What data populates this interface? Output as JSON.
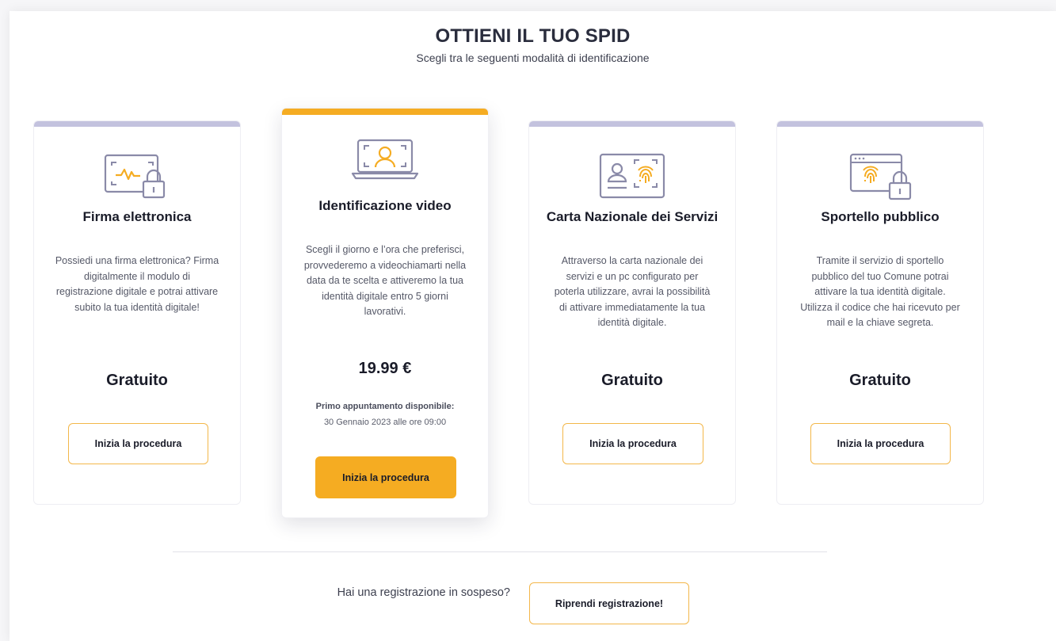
{
  "header": {
    "title": "OTTIENI IL TUO SPID",
    "subtitle": "Scegli tra le seguenti modalità di identificazione"
  },
  "cards": [
    {
      "icon": "signature-lock-icon",
      "title": "Firma elettronica",
      "description": "Possiedi una firma elettronica? Firma digitalmente il modulo di registrazione digitale e potrai attivare subito la tua identità digitale!",
      "price": "Gratuito",
      "button": "Inizia la procedura"
    },
    {
      "icon": "video-identification-icon",
      "title": "Identificazione video",
      "description": "Scegli il giorno e l’ora che preferisci, provvederemo a videochiamarti nella data da te scelta e attiveremo la tua identità digitale entro 5 giorni lavorativi.",
      "price": "19.99 €",
      "appointment_label": "Primo appuntamento disponibile:",
      "appointment_date": "30 Gennaio 2023 alle ore 09:00",
      "button": "Inizia la procedura"
    },
    {
      "icon": "id-card-fingerprint-icon",
      "title": "Carta Nazionale dei Servizi",
      "description": "Attraverso la carta nazionale dei servizi e un pc configurato per poterla utilizzare, avrai la possibilità di attivare immediatamente la tua identità digitale.",
      "price": "Gratuito",
      "button": "Inizia la procedura"
    },
    {
      "icon": "browser-fingerprint-lock-icon",
      "title": "Sportello pubblico",
      "description": "Tramite il servizio di sportello pubblico del tuo Comune potrai attivare la tua identità digitale. Utilizza il codice che hai ricevuto per mail e la chiave segreta.",
      "price": "Gratuito",
      "button": "Inizia la procedura"
    }
  ],
  "footer": {
    "pending_text": "Hai una registrazione in sospeso?",
    "resume_button": "Riprendi registrazione!"
  },
  "colors": {
    "accent": "#f5ac22",
    "card_top_bar": "#c3c2de",
    "icon_stroke": "#8a8aa8",
    "icon_accent": "#f5ac22"
  }
}
